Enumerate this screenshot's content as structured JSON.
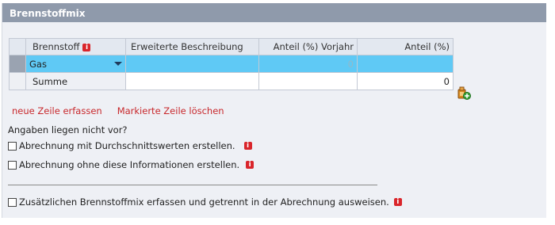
{
  "panel": {
    "title": "Brennstoffmix"
  },
  "table": {
    "columns": [
      "Brennstoff",
      "Erweiterte Beschreibung",
      "Anteil (%) Vorjahr",
      "Anteil (%)"
    ],
    "rows": [
      {
        "fuel": "Gas",
        "description": "",
        "previous_year": "0",
        "share": ""
      }
    ],
    "sum_row": {
      "label": "Summe",
      "description": "",
      "previous_year": "",
      "share": "0"
    }
  },
  "actions": {
    "add_row": "neue Zeile erfassen",
    "delete_row": "Markierte Zeile löschen"
  },
  "missing_info_label": "Angaben liegen nicht vor?",
  "options": [
    {
      "label": "Abrechnung mit Durchschnittswerten erstellen.",
      "checked": false
    },
    {
      "label": "Abrechnung ohne diese Informationen erstellen.",
      "checked": false
    },
    {
      "label": "Zusätzlichen Brennstoffmix erfassen und getrennt in der Abrechnung ausweisen.",
      "checked": false
    }
  ],
  "info_icon_text": "i",
  "colors": {
    "header_bg": "#8f9aab",
    "selected_row": "#5fc9f5",
    "link": "#c8282c",
    "info_icon": "#d9252b"
  }
}
